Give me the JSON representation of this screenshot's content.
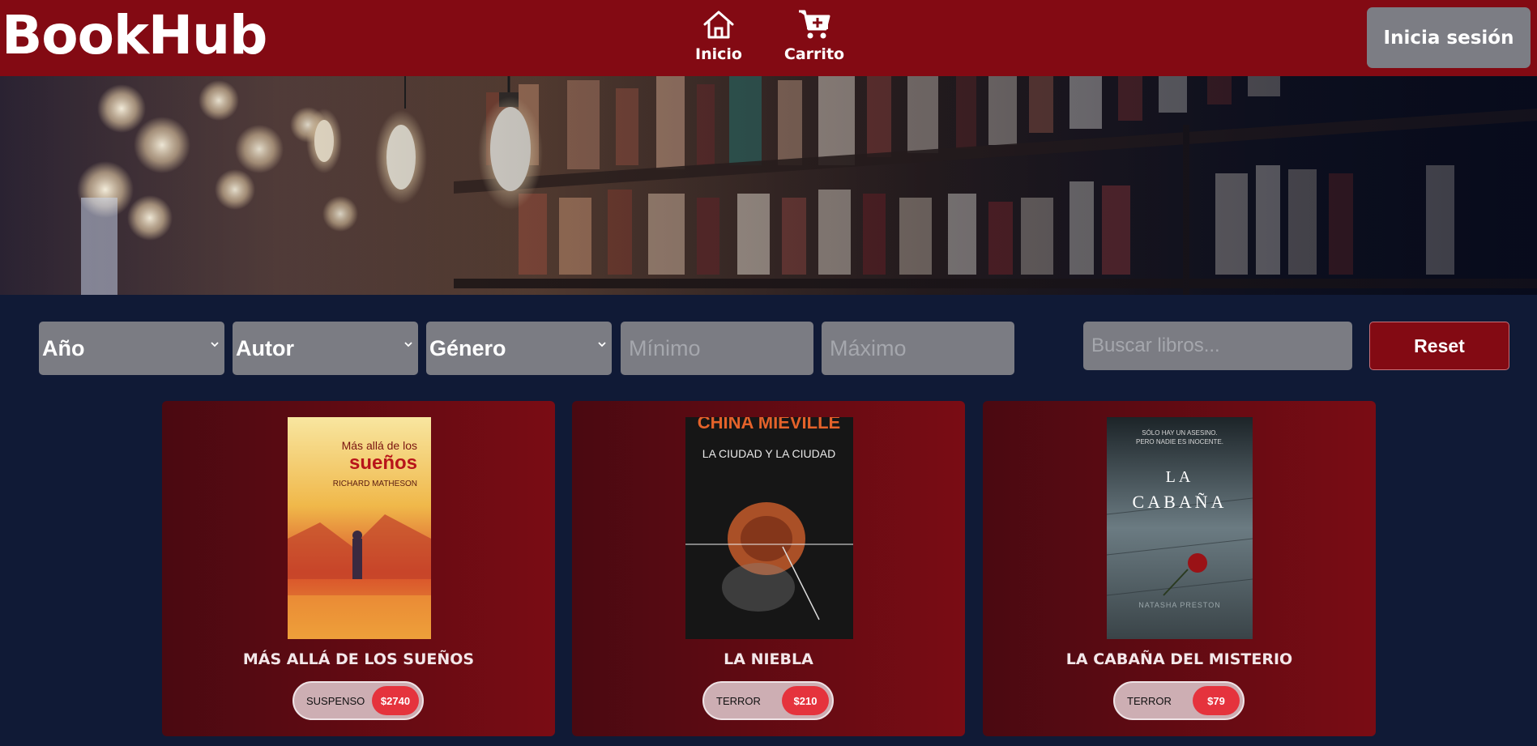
{
  "header": {
    "logo": "BookHub",
    "nav": [
      {
        "label": "Inicio",
        "icon": "home-icon"
      },
      {
        "label": "Carrito",
        "icon": "cart-icon"
      }
    ],
    "login_label": "Inicia sesión"
  },
  "filters": {
    "year_label": "Año",
    "author_label": "Autor",
    "genre_label": "Género",
    "min_placeholder": "Mínimo",
    "max_placeholder": "Máximo",
    "search_placeholder": "Buscar libros...",
    "reset_label": "Reset"
  },
  "books": [
    {
      "title": "MÁS ALLÁ DE LOS SUEÑOS",
      "genre": "SUSPENSO",
      "price": "$2740",
      "cover": {
        "line1": "Más allá de los",
        "line2": "sueños",
        "author": "RICHARD MATHESON"
      }
    },
    {
      "title": "LA NIEBLA",
      "genre": "TERROR",
      "price": "$210",
      "cover": {
        "line1": "CHINA MIÉVILLE",
        "line2": "LA CIUDAD Y LA CIUDAD"
      }
    },
    {
      "title": "LA CABAÑA DEL MISTERIO",
      "genre": "TERROR",
      "price": "$79",
      "cover": {
        "tagline1": "SÓLO HAY UN ASESINO.",
        "tagline2": "PERO NADIE ES INOCENTE.",
        "line1": "LA",
        "line2": "CABAÑA",
        "author": "NATASHA PRESTON"
      }
    }
  ],
  "colors": {
    "header_bg": "#830a13",
    "page_bg": "#101a36",
    "filter_bg": "#7b7c83",
    "price_badge": "#e5333d"
  }
}
